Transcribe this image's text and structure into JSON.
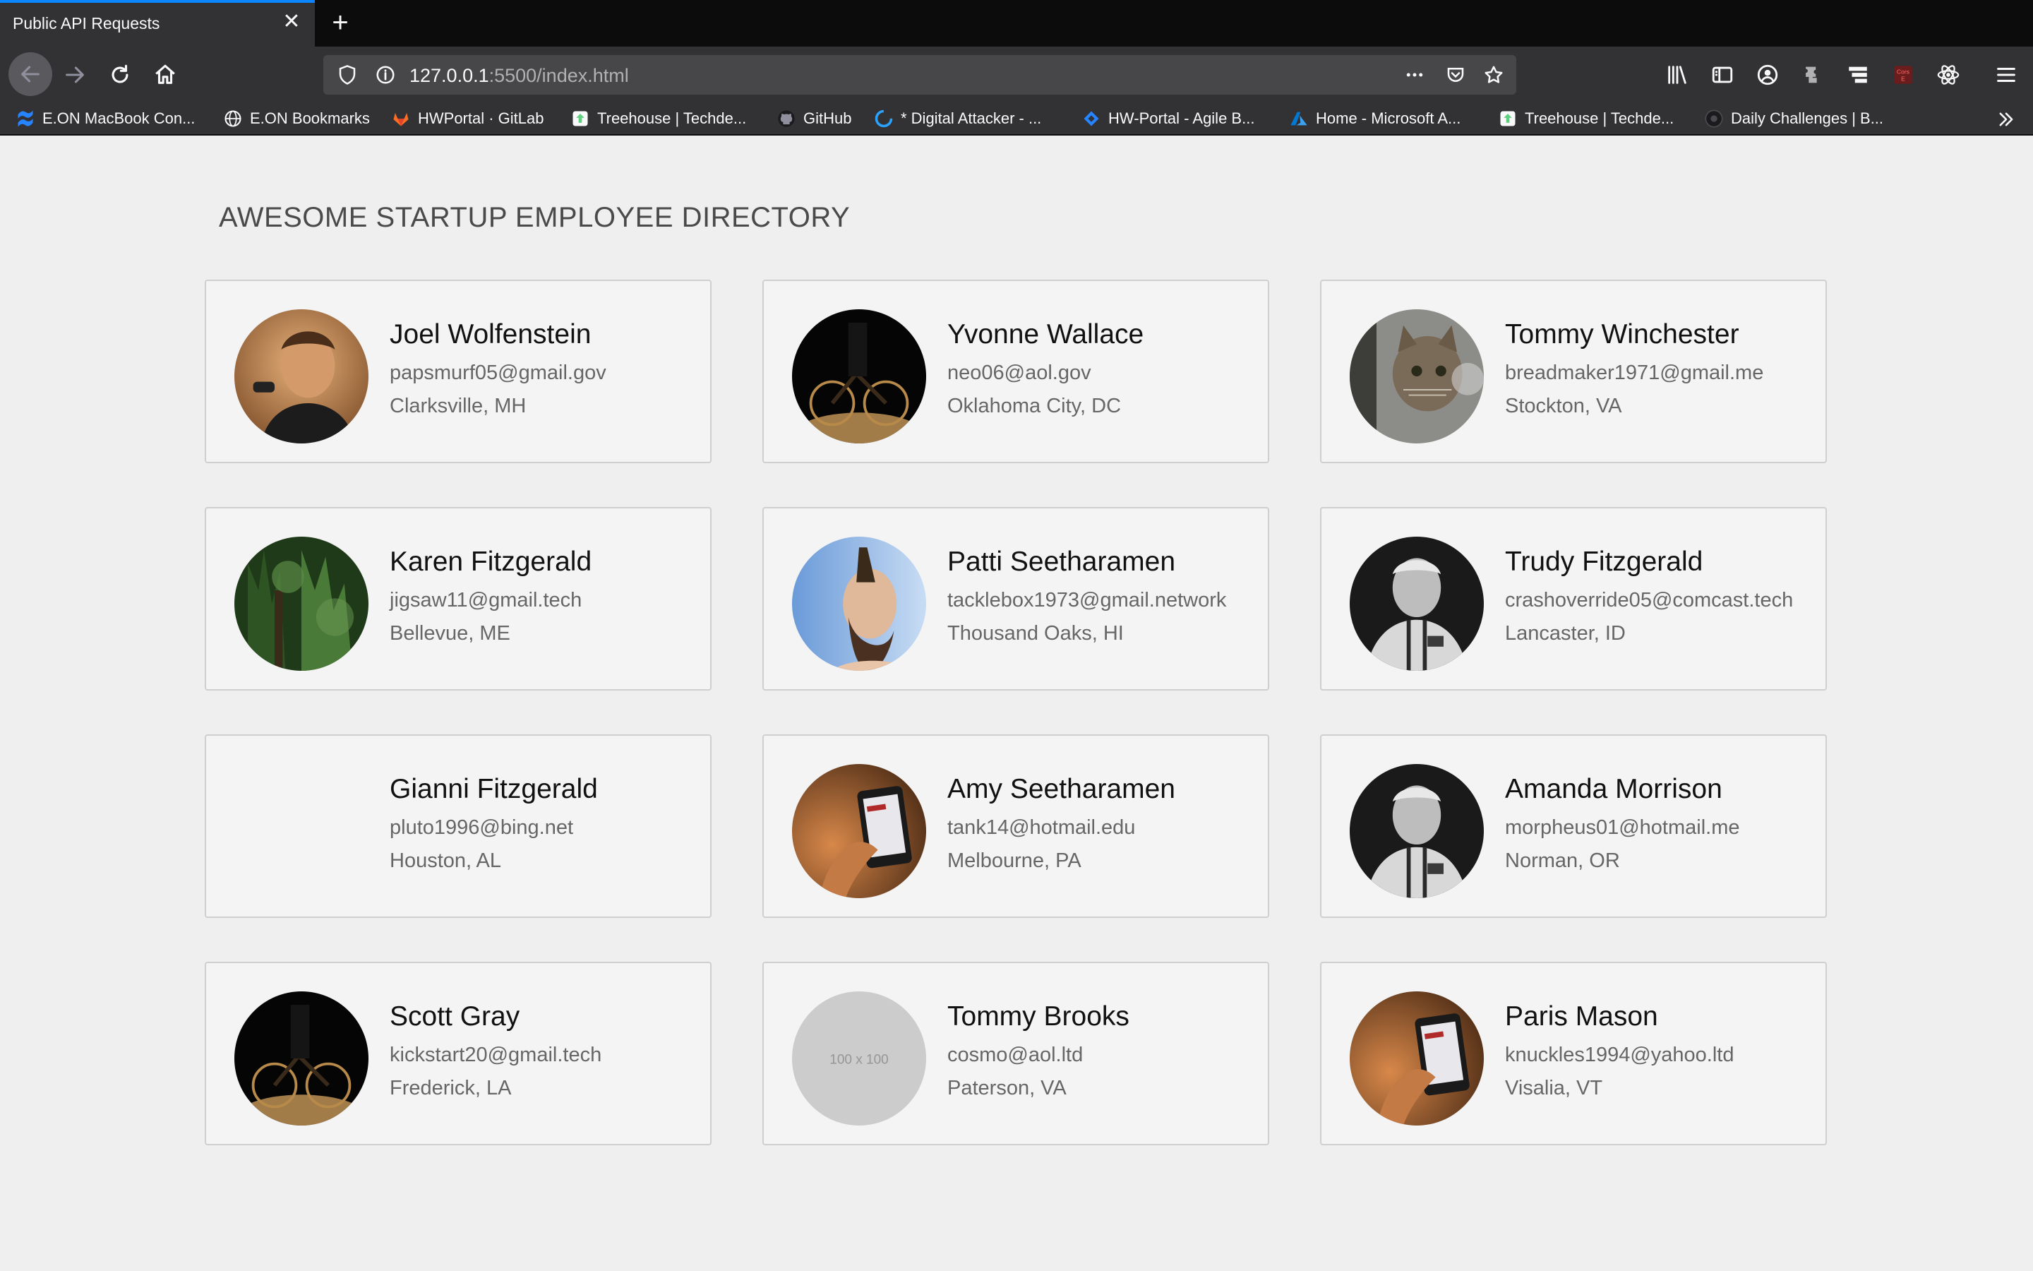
{
  "browser": {
    "tab_title": "Public API Requests",
    "url_host": "127.0.0.1",
    "url_rest": ":5500/index.html",
    "accent_color": "#0a84ff",
    "toolbar_icons": [
      "library-icon",
      "sidebar-icon",
      "account-icon",
      "extension-icon",
      "container-icon",
      "cors-extension-icon",
      "react-devtools-icon",
      "menu-icon"
    ],
    "bookmarks": [
      {
        "label": "E.ON MacBook Con...",
        "icon": "confluence-icon"
      },
      {
        "label": "E.ON Bookmarks",
        "icon": "globe-icon"
      },
      {
        "label": "HWPortal · GitLab",
        "icon": "gitlab-icon"
      },
      {
        "label": "Treehouse | Techde...",
        "icon": "treehouse-icon"
      },
      {
        "label": "GitHub",
        "icon": "github-icon"
      },
      {
        "label": "* Digital Attacker - ...",
        "icon": "digital-attacker-icon"
      },
      {
        "label": "HW-Portal - Agile B...",
        "icon": "jira-icon"
      },
      {
        "label": "Home - Microsoft A...",
        "icon": "azure-icon"
      },
      {
        "label": "Treehouse | Techde...",
        "icon": "treehouse-icon"
      },
      {
        "label": "Daily Challenges | B...",
        "icon": "challenges-icon"
      }
    ]
  },
  "page": {
    "title": "AWESOME STARTUP EMPLOYEE DIRECTORY"
  },
  "employees": [
    {
      "name": "Joel Wolfenstein",
      "email": "papsmurf05@gmail.gov",
      "location": "Clarksville, MH",
      "avatar": "portrait"
    },
    {
      "name": "Yvonne Wallace",
      "email": "neo06@aol.gov",
      "location": "Oklahoma City, DC",
      "avatar": "bicycle"
    },
    {
      "name": "Tommy Winchester",
      "email": "breadmaker1971@gmail.me",
      "location": "Stockton, VA",
      "avatar": "cat"
    },
    {
      "name": "Karen Fitzgerald",
      "email": "jigsaw11@gmail.tech",
      "location": "Bellevue, ME",
      "avatar": "forest"
    },
    {
      "name": "Patti Seetharamen",
      "email": "tacklebox1973@gmail.network",
      "location": "Thousand Oaks, HI",
      "avatar": "mohawk"
    },
    {
      "name": "Trudy Fitzgerald",
      "email": "crashoverride05@comcast.tech",
      "location": "Lancaster, ID",
      "avatar": "bw-portrait"
    },
    {
      "name": "Gianni Fitzgerald",
      "email": "pluto1996@bing.net",
      "location": "Houston, AL",
      "avatar": "none"
    },
    {
      "name": "Amy Seetharamen",
      "email": "tank14@hotmail.edu",
      "location": "Melbourne, PA",
      "avatar": "phone"
    },
    {
      "name": "Amanda Morrison",
      "email": "morpheus01@hotmail.me",
      "location": "Norman, OR",
      "avatar": "bw-portrait"
    },
    {
      "name": "Scott Gray",
      "email": "kickstart20@gmail.tech",
      "location": "Frederick, LA",
      "avatar": "bicycle"
    },
    {
      "name": "Tommy Brooks",
      "email": "cosmo@aol.ltd",
      "location": "Paterson, VA",
      "avatar": "placeholder",
      "placeholder_text": "100 x 100"
    },
    {
      "name": "Paris Mason",
      "email": "knuckles1994@yahoo.ltd",
      "location": "Visalia, VT",
      "avatar": "phone"
    }
  ]
}
